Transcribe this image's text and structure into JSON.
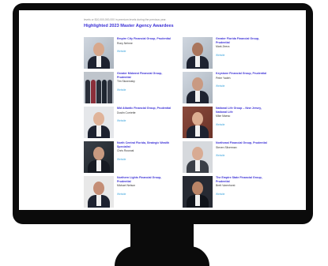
{
  "intro": "levels or $10,000,000,000 in premium levels during the previous year.",
  "heading": "Highlighted 2023 Master Agency Awardees",
  "link_label": "Website",
  "awardees": [
    {
      "office": "Empire City Financial Group, Prudential",
      "name": "Rony Nehme"
    },
    {
      "office": "Greater Florida Financial Group, Prudential",
      "name": "Mark Zeera"
    },
    {
      "office": "Greater Midwest Financial Group, Prudential",
      "name": "Tim Skowrosky"
    },
    {
      "office": "Keystone Financial Group, Prudential",
      "name": "Peter Yadeh"
    },
    {
      "office": "Mid Atlantic Financial Group, Prudential",
      "name": "Dustin Corriette"
    },
    {
      "office": "National Life Group – New Jersey, National Life",
      "name": "Mike Maeso"
    },
    {
      "office": "North Central Florida, Strategic Wealth Specialist",
      "name": "Chris Rousnal"
    },
    {
      "office": "Northeast Financial Group, Prudential",
      "name": "Steven Silverman"
    },
    {
      "office": "Northern Lights Financial Group, Prudential",
      "name": "Michael Nelson"
    },
    {
      "office": "The Empire State Financial Group, Prudential",
      "name": "Brett Varenhorst"
    }
  ]
}
